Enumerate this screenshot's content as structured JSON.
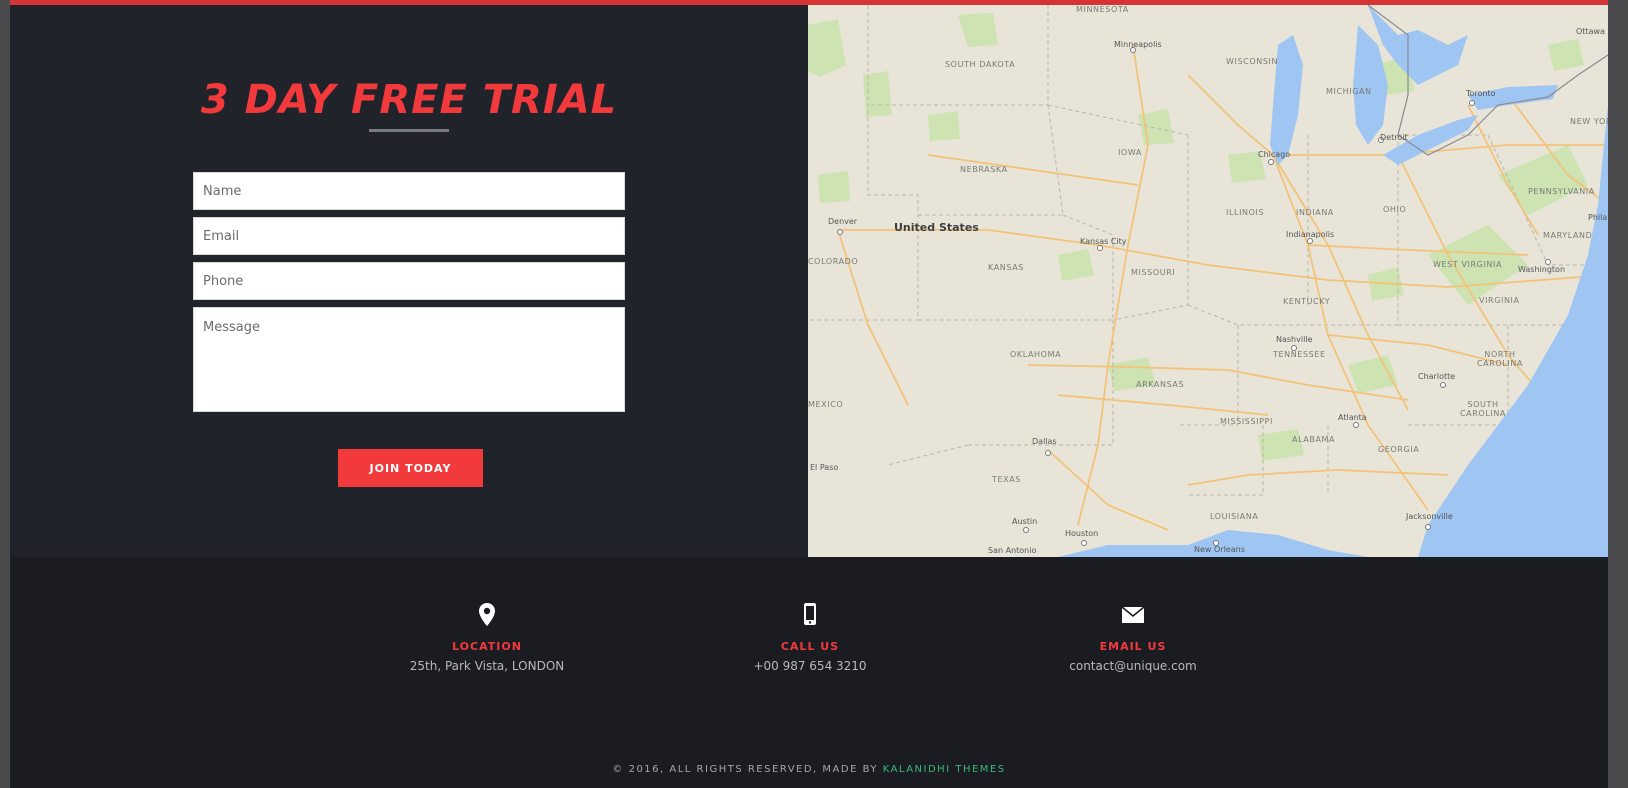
{
  "colors": {
    "accent": "#f23a3d",
    "topbar": "#d63335",
    "panel_bg": "#21232b",
    "footer_bg": "#1b1c21",
    "credit_link": "#3cb878"
  },
  "trial": {
    "title": "3 DAY FREE TRIAL",
    "form": {
      "name_placeholder": "Name",
      "email_placeholder": "Email",
      "phone_placeholder": "Phone",
      "message_placeholder": "Message",
      "submit_label": "JOIN TODAY"
    }
  },
  "map": {
    "country": "United States",
    "states": [
      "MINNESOTA",
      "SOUTH DAKOTA",
      "WISCONSIN",
      "MICHIGAN",
      "NEBRASKA",
      "IOWA",
      "ILLINOIS",
      "INDIANA",
      "OHIO",
      "PENNSYLVANIA",
      "COLORADO",
      "KANSAS",
      "MISSOURI",
      "KENTUCKY",
      "WEST VIRGINIA",
      "VIRGINIA",
      "MARYLAND",
      "OKLAHOMA",
      "TENNESSEE",
      "NORTH CAROLINA",
      "ARKANSAS",
      "MEXICO",
      "MISSISSIPPI",
      "ALABAMA",
      "GEORGIA",
      "SOUTH CAROLINA",
      "TEXAS",
      "LOUISIANA",
      "NEW YORK"
    ],
    "cities": [
      "Minneapolis",
      "Toronto",
      "Detroit",
      "Chicago",
      "Denver",
      "Kansas City",
      "Indianapolis",
      "Washington",
      "Nashville",
      "Charlotte",
      "Atlanta",
      "Dallas",
      "Austin",
      "Houston",
      "Jacksonville",
      "New Orleans",
      "El Paso",
      "San Antonio",
      "Ottawa",
      "Phila"
    ]
  },
  "contact": {
    "location": {
      "icon": "map-pin-icon",
      "label": "LOCATION",
      "value": "25th, Park Vista, LONDON"
    },
    "call": {
      "icon": "mobile-phone-icon",
      "label": "CALL US",
      "value": "+00 987 654 3210"
    },
    "email": {
      "icon": "envelope-icon",
      "label": "EMAIL US",
      "value": "contact@unique.com"
    }
  },
  "footer": {
    "copyright": "© 2016,  ALL RIGHTS RESERVED, MADE BY",
    "credit": "KALANIDHI THEMES"
  }
}
